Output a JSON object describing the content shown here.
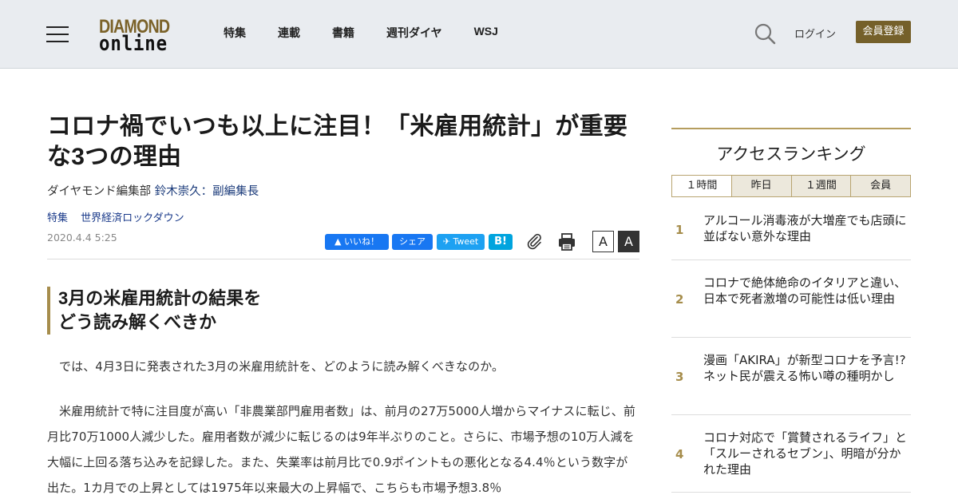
{
  "header": {
    "logo_top": "DIAMOND",
    "logo_bottom": "online",
    "nav": [
      "特集",
      "連載",
      "書籍",
      "週刊ダイヤ",
      "WSJ"
    ],
    "login": "ログイン",
    "register": "会員登録"
  },
  "article": {
    "title": "コロナ禍でいつも以上に注目！「米雇用統計」が重要な3つの理由",
    "byline_prefix": "ダイヤモンド編集部 ",
    "byline_author": "鈴木崇久：副編集長",
    "tags": [
      "特集",
      "世界経済ロックダウン"
    ],
    "date": "2020.4.4 5:25",
    "share": {
      "like": "いいね！",
      "share": "シェア",
      "tweet": "Tweet",
      "hatena": "B!"
    },
    "font_size_labels": [
      "A",
      "A"
    ],
    "subheading_line1": "3月の米雇用統計の結果を",
    "subheading_line2": "どう読み解くべきか",
    "paragraphs": [
      "では、4月3日に発表された3月の米雇用統計を、どのように読み解くべきなのか。",
      "米雇用統計で特に注目度が高い「非農業部門雇用者数」は、前月の27万5000人増からマイナスに転じ、前月比70万1000人減少した。雇用者数が減少に転じるのは9年半ぶりのこと。さらに、市場予想の10万人減を大幅に上回る落ち込みを記録した。また、失業率は前月比で0.9ポイントもの悪化となる4.4％という数字が出た。1カ月での上昇としては1975年以来最大の上昇幅で、こちらも市場予想3.8％"
    ]
  },
  "sidebar": {
    "title": "アクセスランキング",
    "tabs": [
      "１時間",
      "昨日",
      "１週間",
      "会員"
    ],
    "ranking": [
      {
        "rank": "1",
        "text": "アルコール消毒液が大増産でも店頭に並ばない意外な理由"
      },
      {
        "rank": "2",
        "text": "コロナで絶体絶命のイタリアと違い、日本で死者激増の可能性は低い理由"
      },
      {
        "rank": "3",
        "text": "漫画「AKIRA」が新型コロナを予言!?ネット民が震える怖い噂の種明かし"
      },
      {
        "rank": "4",
        "text": "コロナ対応で「賞賛されるライフ」と「スルーされるセブン」、明暗が分かれた理由"
      }
    ]
  }
}
